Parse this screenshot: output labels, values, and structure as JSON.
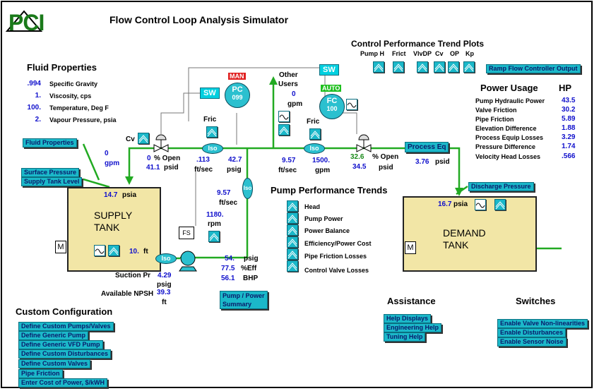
{
  "app": {
    "title": "Flow Control Loop Analysis Simulator",
    "logo_text": "PCI"
  },
  "fluid": {
    "heading": "Fluid Properties",
    "rows": [
      {
        "value": ".994",
        "label": "Specific Gravity"
      },
      {
        "value": "1.",
        "label": "Viscosity, cps"
      },
      {
        "value": "100.",
        "label": "Temperature, Deg F"
      },
      {
        "value": "2.",
        "label": "Vapour Pressure, psia"
      }
    ]
  },
  "left_buttons": {
    "fluid_properties": "Fluid Properties",
    "surface_pressure": "Surface Pressure",
    "supply_tank_level": "Supply Tank Level"
  },
  "supply_tank": {
    "label_line1": "SUPPLY",
    "label_line2": "TANK",
    "pressure_value": "14.7",
    "pressure_unit": "psia",
    "level_value": "10.",
    "level_unit": "ft",
    "motor": "M"
  },
  "demand_tank": {
    "label_line1": "DEMAND",
    "label_line2": "TANK",
    "pressure_value": "16.7",
    "pressure_unit": "psia",
    "motor": "M"
  },
  "valve_left": {
    "cv_label": "Cv",
    "open_value": "0",
    "open_label": "% Open",
    "psid_value": "41.1",
    "psid_unit": "psid"
  },
  "flow_left": {
    "value": "0",
    "unit": "gpm"
  },
  "controllers": {
    "man_label": "MAN",
    "pc_line1": "PC",
    "pc_line2": "099",
    "auto_label": "AUTO",
    "fc_line1": "FC",
    "fc_line2": "100",
    "sw_label": "SW"
  },
  "other_users": {
    "line1": "Other",
    "line2": "Users",
    "value": "0",
    "unit": "gpm"
  },
  "pipe1": {
    "fric_label": "Fric",
    "vel_value": ".113",
    "vel_unit": "ft/sec",
    "psig_value": "42.7",
    "psig_unit": "psig"
  },
  "pipe2": {
    "fric_label": "Fric",
    "vel_value": "9.57",
    "vel_unit": "ft/sec",
    "gpm_value": "1500.",
    "gpm_unit": "gpm"
  },
  "pipe3": {
    "vel_value": "9.57",
    "vel_unit": "ft/sec"
  },
  "iso_label": "Iso",
  "valve_right": {
    "open_value": "32.6",
    "open_label": "% Open",
    "psid_value": "34.5",
    "psid_unit": "psid"
  },
  "process_eq": {
    "button": "Process Eq",
    "value": "3.76",
    "unit": "psid"
  },
  "discharge_pressure": "Discharge Pressure",
  "pump": {
    "rpm_value": "1180.",
    "rpm_unit": "rpm",
    "fs_label": "FS",
    "psig_value": "54.",
    "psig_unit": "psig",
    "eff_value": "77.5",
    "eff_unit": "%Eff",
    "bhp_value": "56.1",
    "bhp_unit": "BHP",
    "suction_label": "Suction Pr",
    "suction_value": "4.29",
    "suction_unit": "psig",
    "npsh_label": "Available NPSH",
    "npsh_value": "39.3",
    "npsh_unit": "ft",
    "summary_line1": "Pump / Power",
    "summary_line2": "Summary"
  },
  "trend_plots": {
    "heading": "Control Performance Trend Plots",
    "labels": [
      "Pump H",
      "Frict",
      "VlvDP",
      "Cv",
      "OP",
      "Kp"
    ],
    "ramp_button": "Ramp Flow Controller Output"
  },
  "power": {
    "heading": "Power Usage",
    "unit_heading": "HP",
    "rows": [
      {
        "label": "Pump Hydraulic Power",
        "value": "43.5"
      },
      {
        "label": "Valve Friction",
        "value": "30.2"
      },
      {
        "label": "Pipe Friction",
        "value": "5.89"
      },
      {
        "label": "Elevation Difference",
        "value": "1.88"
      },
      {
        "label": "Process Equip Losses",
        "value": "3.29"
      },
      {
        "label": "Pressure Difference",
        "value": "1.74"
      },
      {
        "label": "Velocity Head Losses",
        "value": ".566"
      }
    ]
  },
  "pump_trends": {
    "heading": "Pump Performance Trends",
    "items": [
      "Head",
      "Pump Power",
      "Power Balance",
      "Efficiency/Power Cost",
      "Pipe Friction Losses",
      "Control Valve Losses"
    ]
  },
  "custom": {
    "heading": "Custom Configuration",
    "buttons": [
      "Define Custom Pumps/Valves",
      "Define Generic Pump",
      "Define Generic VFD Pump",
      "Define Custom Disturbances",
      "Define Custom Valves",
      "Pipe Friction",
      "Enter Cost of Power, $/kWH"
    ]
  },
  "assistance": {
    "heading": "Assistance",
    "buttons": [
      "Help Displays",
      "Engineering Help",
      "Tuning Help"
    ]
  },
  "switches": {
    "heading": "Switches",
    "buttons": [
      "Enable Valve Non-linearities",
      "Enable Disturbances",
      "Enable Sensor Noise"
    ]
  },
  "colors": {
    "pipe": "#22aa22",
    "button": "#1bb8c9",
    "value_text": "#1010cc",
    "tank_fill": "#f2e6a6",
    "man": "#e02020",
    "auto": "#20c020"
  }
}
